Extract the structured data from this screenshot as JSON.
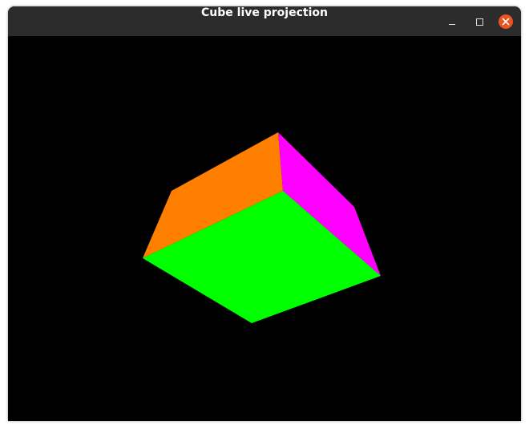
{
  "window": {
    "title": "Cube live projection",
    "controls": [
      "minimize-icon",
      "maximize-icon",
      "close-icon"
    ],
    "close_color": "#e95420"
  },
  "scene": {
    "background": "#000000",
    "faces": [
      {
        "name": "orange-face",
        "color": "#ff8000"
      },
      {
        "name": "magenta-face",
        "color": "#ff00ff"
      },
      {
        "name": "green-face",
        "color": "#00ff00"
      }
    ]
  }
}
